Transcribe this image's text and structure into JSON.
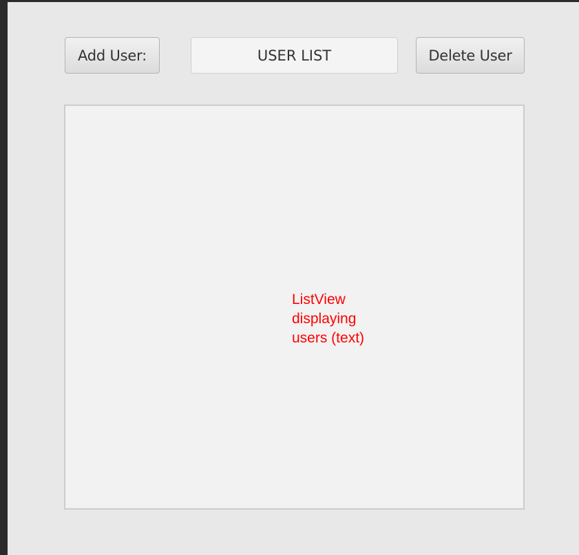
{
  "toolbar": {
    "add_user_label": "Add User:",
    "title_text": "USER LIST",
    "delete_user_label": "Delete User"
  },
  "list_view": {
    "annotation": "ListView\ndisplaying\nusers (text)"
  },
  "colors": {
    "window_background": "#e8e8e8",
    "outer_background": "#2b2b2b",
    "list_background": "#f2f2f2",
    "annotation_text": "#ff0000"
  }
}
